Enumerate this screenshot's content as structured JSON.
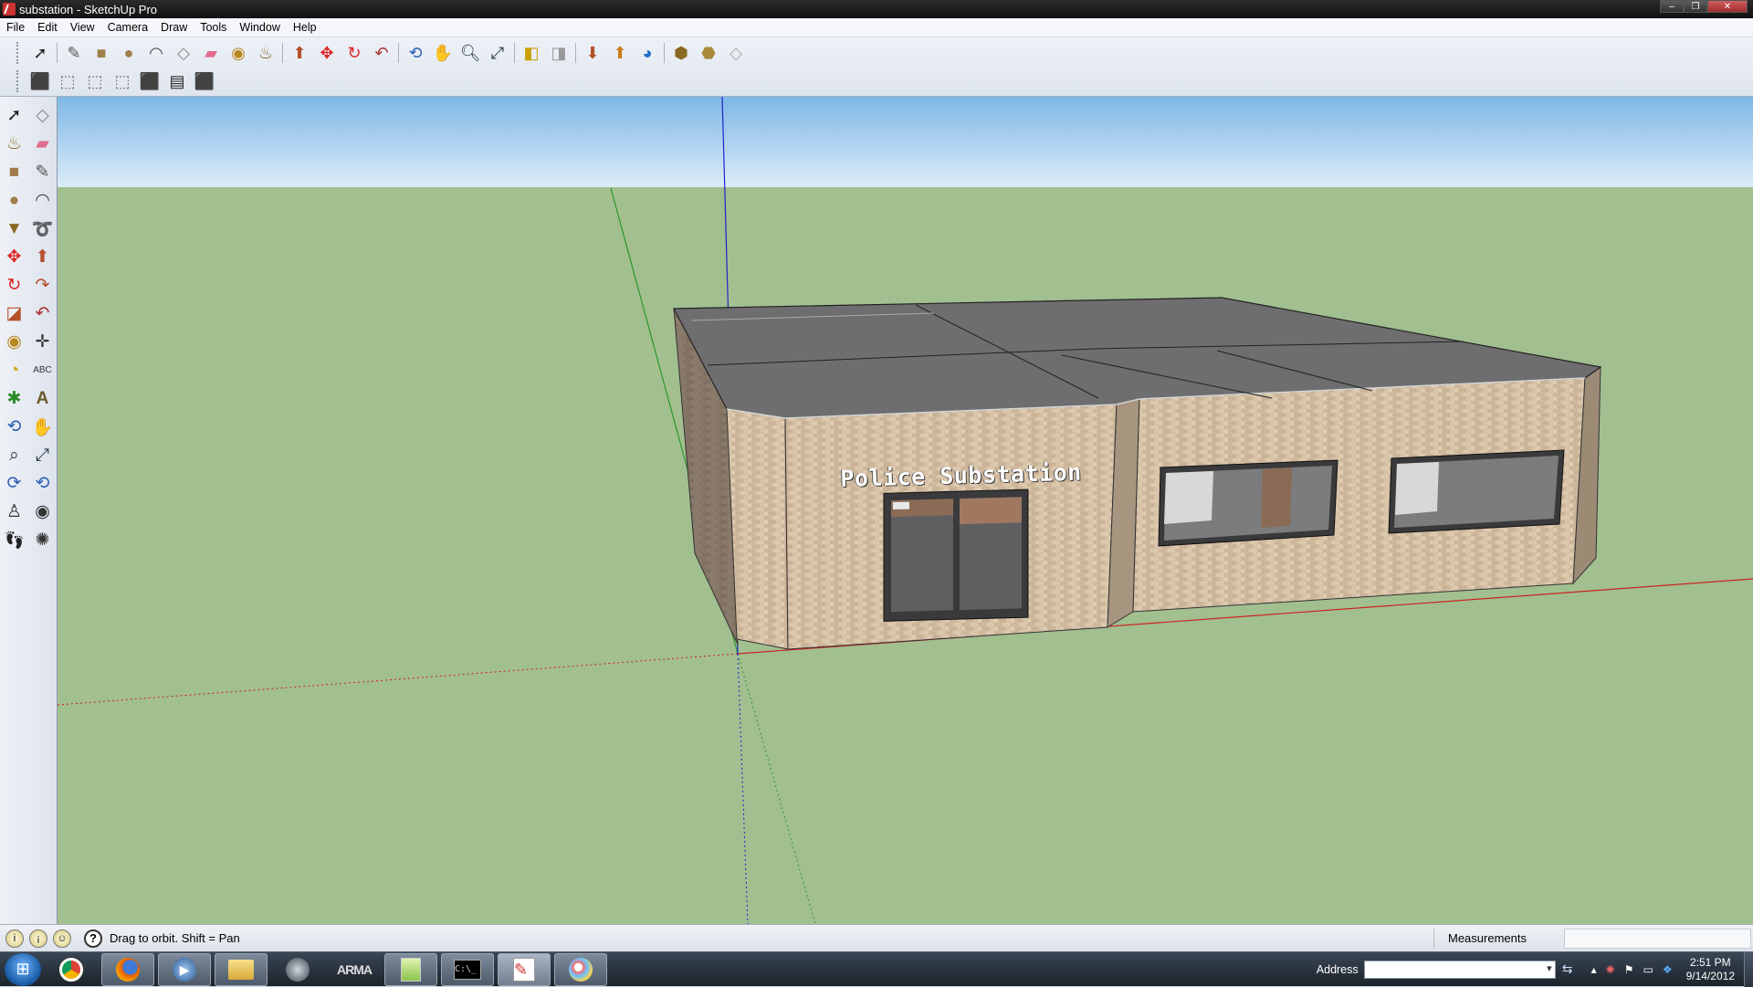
{
  "window": {
    "title": "substation - SketchUp Pro",
    "minimize": "–",
    "maximize": "❐",
    "close": "✕"
  },
  "menu": [
    "File",
    "Edit",
    "View",
    "Camera",
    "Draw",
    "Tools",
    "Window",
    "Help"
  ],
  "toolbar_row1": [
    "select-icon",
    "line-icon",
    "rectangle-icon",
    "circle-icon",
    "arc-icon",
    "make-component-icon",
    "eraser-icon",
    "tape-measure-icon",
    "paint-bucket-icon",
    "push-pull-icon",
    "move-icon",
    "rotate-icon",
    "offset-icon",
    "orbit-icon",
    "pan-icon",
    "zoom-icon",
    "zoom-extents-icon",
    "previous-view-icon",
    "next-view-icon",
    "get-models-icon",
    "share-model-icon",
    "share-component-icon",
    "google-earth-icon",
    "3d-warehouse-icon",
    "extension-icon",
    "preferences-icon"
  ],
  "toolbar_row2": [
    "iso-view-icon",
    "top-view-icon",
    "front-view-icon",
    "right-view-icon",
    "back-view-icon",
    "left-view-icon",
    "xray-icon"
  ],
  "model": {
    "sign_text": "Police Substation"
  },
  "colors": {
    "sky_top": "#7eb7e6",
    "ground": "#a2bf90",
    "brick": "#d4bfa3",
    "roof": "#6e6e70",
    "red_axis": "#cc2222",
    "green_axis": "#2a9a2a",
    "blue_axis": "#2222cc"
  },
  "status": {
    "message": "Drag to orbit.  Shift = Pan",
    "measurements_label": "Measurements",
    "measurements_value": ""
  },
  "taskbar": {
    "apps": [
      "chrome-icon",
      "firefox-icon",
      "media-player-icon",
      "file-explorer-icon",
      "steam-icon",
      "arma-icon",
      "notepad-icon",
      "command-prompt-icon",
      "sketchup-icon",
      "paint-icon"
    ],
    "address_label": "Address",
    "address_value": "",
    "time": "2:51 PM",
    "date": "9/14/2012"
  }
}
